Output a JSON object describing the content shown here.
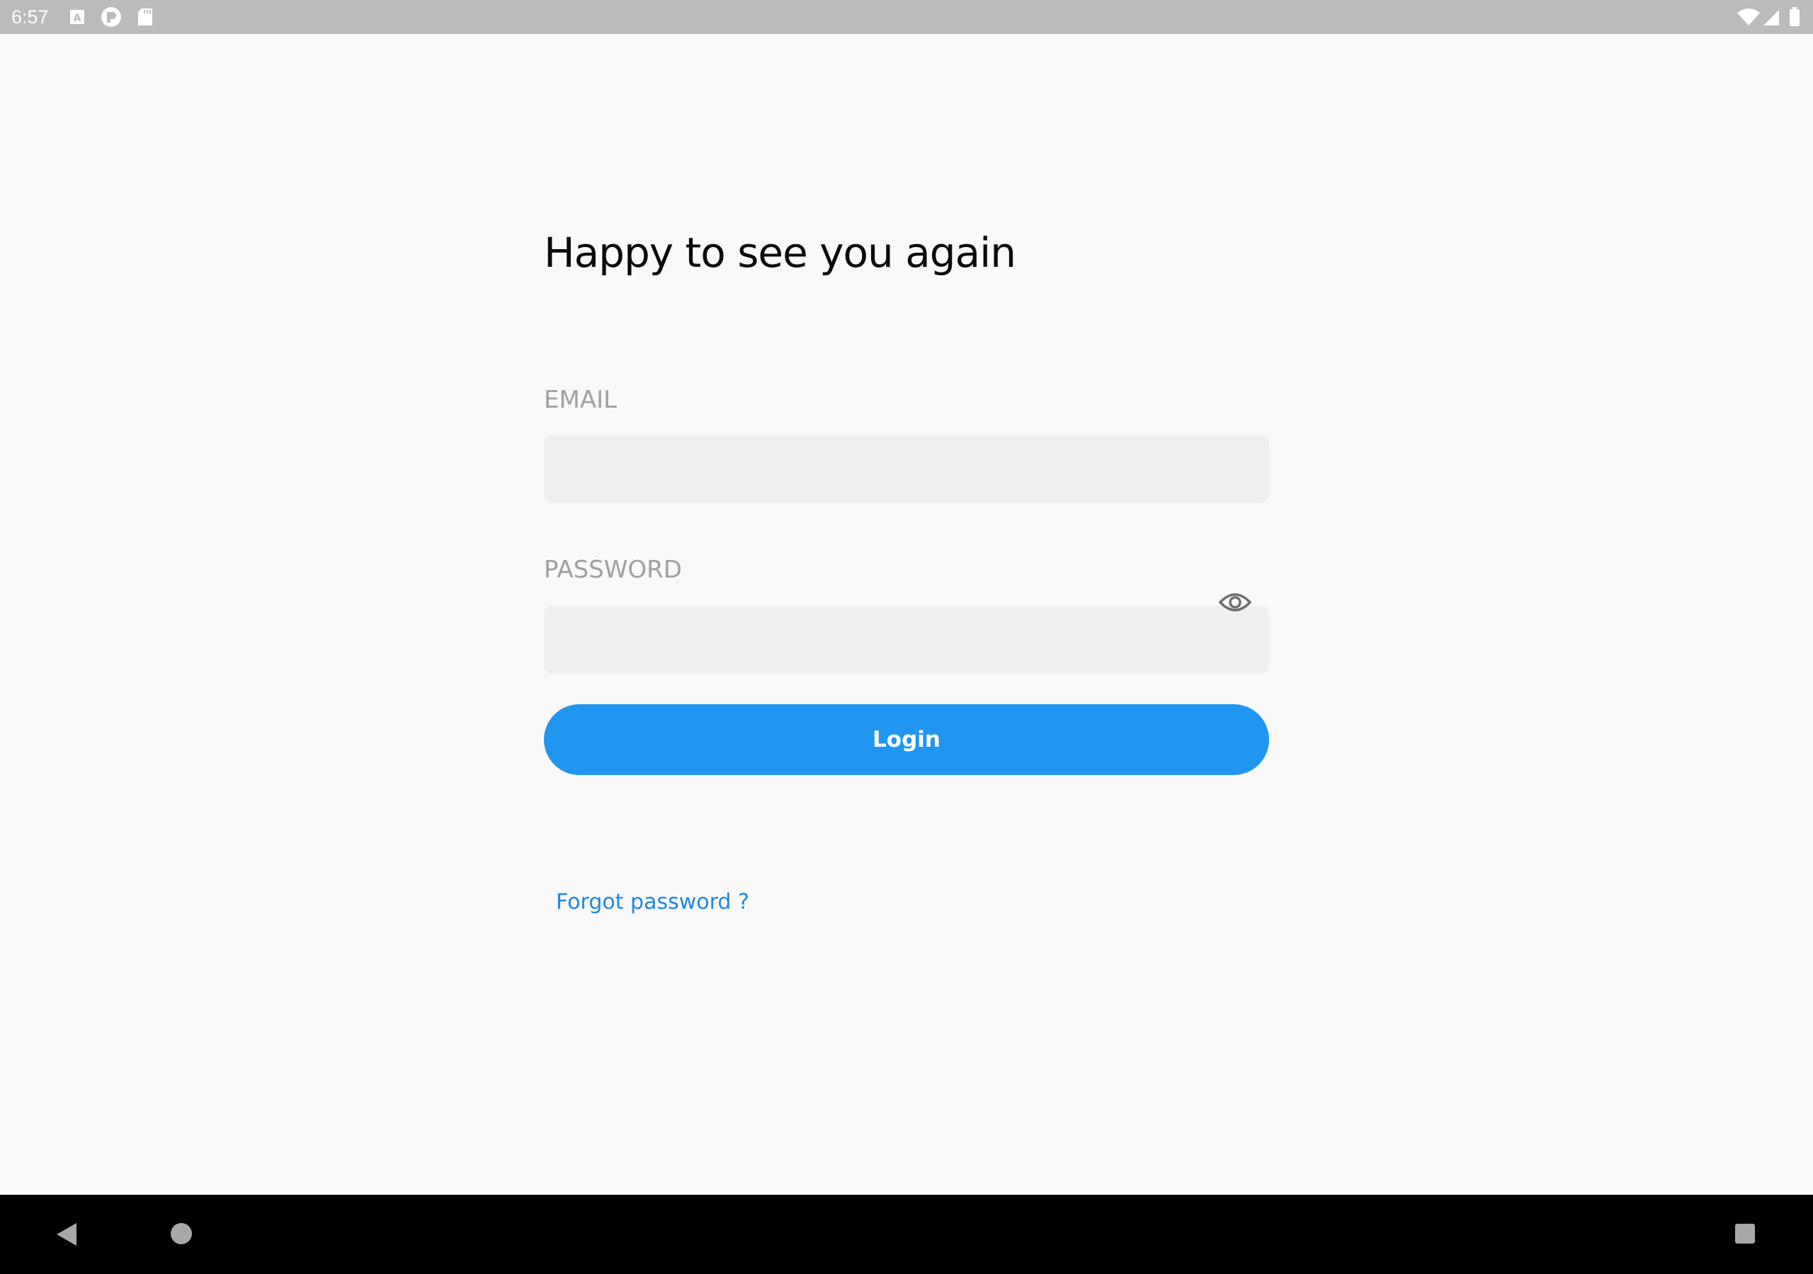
{
  "status_bar": {
    "time": "6:57",
    "notification_icons": [
      "a-keyboard-icon",
      "circle-p-icon",
      "sd-card-icon"
    ],
    "system_icons": [
      "wifi-icon",
      "cellular-signal-icon",
      "battery-icon"
    ]
  },
  "login": {
    "title": "Happy to see you again",
    "email_label": "EMAIL",
    "email_value": "",
    "password_label": "PASSWORD",
    "password_value": "",
    "password_toggle_icon": "eye-icon",
    "login_label": "Login",
    "forgot_label": "Forgot password ?"
  },
  "nav_bar": {
    "buttons": [
      "back-icon",
      "home-icon",
      "recents-icon"
    ]
  },
  "colors": {
    "accent": "#2196f0",
    "link": "#1e88e5",
    "background": "#f9f9f9",
    "input_background": "#efefef",
    "label": "#a0a0a0",
    "status_bar": "#bbbbbb",
    "nav_bar": "#000000"
  }
}
